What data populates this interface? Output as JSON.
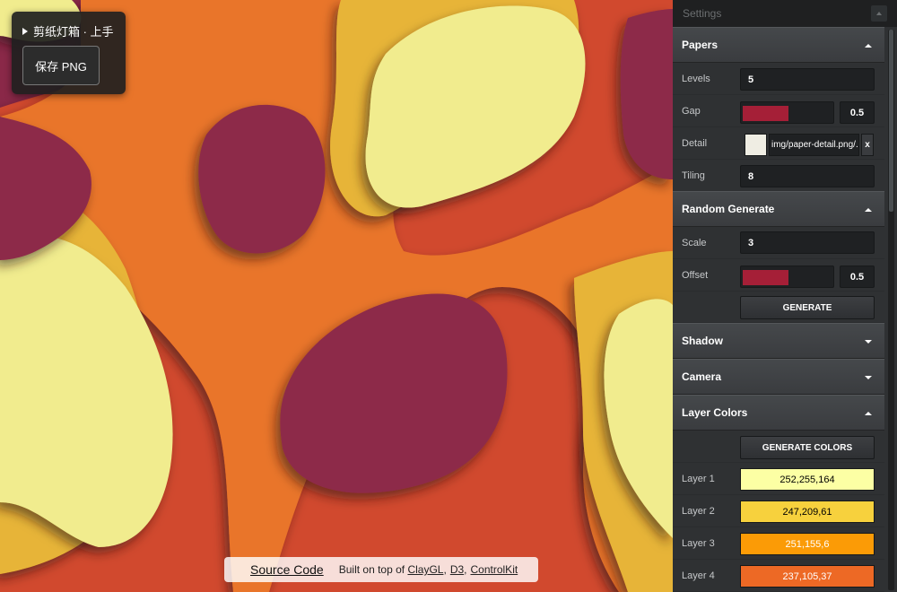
{
  "float_panel": {
    "title": "剪纸灯箱 · 上手",
    "save_label": "保存 PNG"
  },
  "credits": {
    "source_label": "Source Code",
    "built_text": "Built on top of",
    "links": [
      "ClayGL",
      "D3",
      "ControlKit"
    ],
    "separators": [
      ",",
      ","
    ]
  },
  "panel": {
    "title": "Settings",
    "sections": {
      "papers": {
        "title": "Papers",
        "levels_label": "Levels",
        "levels_value": "5",
        "gap_label": "Gap",
        "gap_value": "0.5",
        "gap_fraction": 0.5,
        "detail_label": "Detail",
        "detail_path": "img/paper-detail.png/...",
        "detail_clear": "x",
        "tiling_label": "Tiling",
        "tiling_value": "8"
      },
      "random": {
        "title": "Random Generate",
        "scale_label": "Scale",
        "scale_value": "3",
        "offset_label": "Offset",
        "offset_value": "0.5",
        "offset_fraction": 0.5,
        "generate_label": "GENERATE"
      },
      "shadow": {
        "title": "Shadow"
      },
      "camera": {
        "title": "Camera"
      },
      "layer_colors": {
        "title": "Layer Colors",
        "generate_label": "GENERATE COLORS",
        "layers": [
          {
            "label": "Layer 1",
            "value": "252,255,164",
            "color": "#fcffa4",
            "text": "#000000"
          },
          {
            "label": "Layer 2",
            "value": "247,209,61",
            "color": "#f7d13d",
            "text": "#000000"
          },
          {
            "label": "Layer 3",
            "value": "251,155,6",
            "color": "#fb9b06",
            "text": "#ffffff"
          },
          {
            "label": "Layer 4",
            "value": "237,105,37",
            "color": "#ed6925",
            "text": "#ffffff"
          }
        ]
      }
    }
  }
}
